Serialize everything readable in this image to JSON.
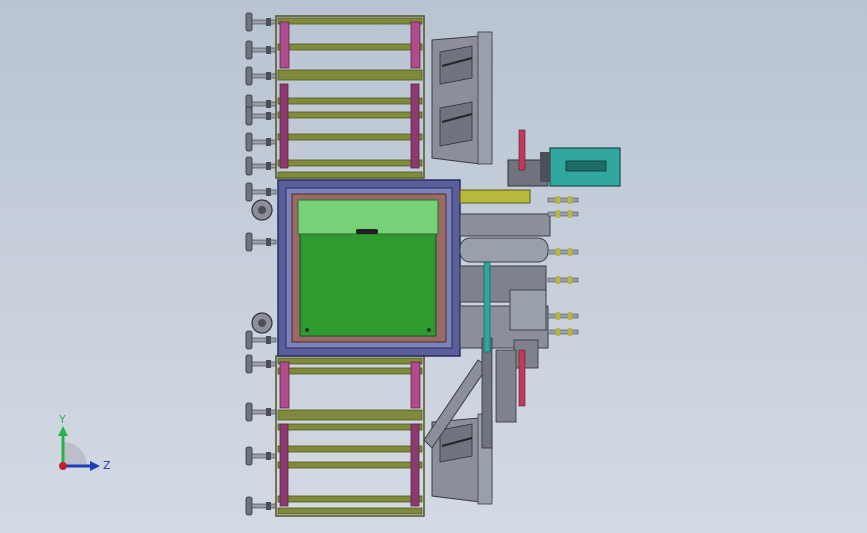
{
  "view": {
    "background_top": "#b9c4d2",
    "background_bottom": "#d4dae3"
  },
  "model": {
    "frame_color": "#7f8b3a",
    "frame_edge": "#4e5520",
    "post_color": "#b04c8c",
    "chamber_outer": "#4a4e8c",
    "chamber_inner": "#9a6a66",
    "glass_color": "#2f9a2f",
    "top_panel": "#77d277",
    "cylinder_color": "#b8b83c",
    "box_color": "#31a7a0",
    "metal_color": "#8a8f99",
    "metal_dark": "#4c4f57",
    "teal_rod": "#2aa89a",
    "red_rod": "#c23a5a"
  },
  "triad": {
    "y_label": "Y",
    "z_label": "Z",
    "y_color": "#2ab24a",
    "z_color": "#1d3fb8",
    "origin_color": "#c0202a"
  }
}
